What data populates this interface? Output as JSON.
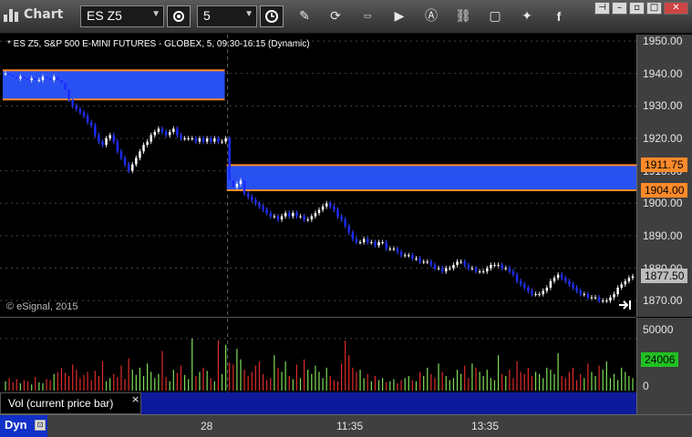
{
  "window": {
    "title": "Chart",
    "symbol": "ES Z5",
    "interval": "5"
  },
  "chart_header": "* ES Z5, S&P 500 E-MINI FUTURES - GLOBEX, 5, 09:30-16:15 (Dynamic)",
  "copyright": "© eSignal, 2015",
  "price_badges": {
    "upper": "1911.75",
    "lower": "1904.00",
    "last": "1877.50",
    "volume_last": "24006"
  },
  "volume_panel": {
    "label": "Vol (current price bar)",
    "close": "×",
    "ticks": [
      "50000",
      "0"
    ]
  },
  "time_axis": {
    "ticks": [
      "28",
      "11:35",
      "13:35"
    ]
  },
  "dyn_label": "Dyn",
  "colors": {
    "zone_fill": "#2a55ff",
    "zone_border": "#ff8a2a",
    "up_candle": "#ffffff",
    "down_candle": "#1a2bff",
    "vol_up": "#7fe05a",
    "vol_down": "#e02a2a"
  },
  "chart_data": {
    "type": "candlestick",
    "ylim": [
      1865,
      1952
    ],
    "yticks": [
      "1950.00",
      "1940.00",
      "1930.00",
      "1920.00",
      "1910.00",
      "1900.00",
      "1890.00",
      "1880.00",
      "1870.00"
    ],
    "zones": [
      {
        "from_bar": 0,
        "to_bar": 58,
        "low": 1932,
        "high": 1941
      },
      {
        "from_bar": 60,
        "to_bar": 180,
        "low": 1904,
        "high": 1911.75
      }
    ],
    "close": [
      1940,
      1939.5,
      1939,
      1938.5,
      1939,
      1938.5,
      1938,
      1938.5,
      1938,
      1938,
      1939,
      1938.5,
      1938,
      1939,
      1938,
      1937,
      1935,
      1932,
      1930,
      1929,
      1928,
      1927,
      1925,
      1924,
      1921,
      1919,
      1918,
      1920,
      1921,
      1919,
      1916,
      1914,
      1912,
      1910,
      1912,
      1914,
      1916,
      1918,
      1919,
      1921,
      1922,
      1923,
      1922,
      1921,
      1922,
      1923,
      1921,
      1920,
      1920,
      1920,
      1920,
      1919,
      1920,
      1919,
      1920,
      1919,
      1920,
      1919,
      1919,
      1920,
      1907,
      1905,
      1906,
      1907,
      1903,
      1902,
      1901,
      1900,
      1899,
      1898,
      1897,
      1896,
      1896,
      1895,
      1896,
      1897,
      1896,
      1897,
      1896,
      1896,
      1895,
      1895,
      1896,
      1897,
      1898,
      1899,
      1900,
      1899,
      1898,
      1896,
      1895,
      1893,
      1891,
      1889,
      1888,
      1888,
      1889,
      1888,
      1888,
      1887,
      1888,
      1888,
      1886,
      1886,
      1886,
      1885,
      1884,
      1884,
      1884,
      1883,
      1883,
      1882,
      1882,
      1882,
      1881,
      1880,
      1880,
      1879,
      1880,
      1880,
      1881,
      1882,
      1882,
      1881,
      1880,
      1880,
      1879,
      1879,
      1879,
      1880,
      1881,
      1881,
      1881,
      1880,
      1880,
      1879,
      1878,
      1876,
      1875,
      1874,
      1873,
      1872,
      1872,
      1872,
      1873,
      1874,
      1876,
      1877,
      1878,
      1877,
      1876,
      1875,
      1874,
      1873,
      1872,
      1872,
      1871,
      1871,
      1871,
      1870,
      1870,
      1870,
      1871,
      1872,
      1874,
      1875,
      1876,
      1877,
      1877.5
    ],
    "volume": [
      9000,
      12000,
      8000,
      11000,
      7000,
      10000,
      9000,
      6000,
      13000,
      8000,
      7000,
      11000,
      10000,
      16000,
      18000,
      22000,
      17000,
      14000,
      25000,
      20000,
      12000,
      15000,
      18000,
      10000,
      19000,
      14000,
      28000,
      9000,
      12000,
      16000,
      13000,
      24000,
      11000,
      31000,
      20000,
      15000,
      22000,
      14000,
      26000,
      18000,
      12000,
      16000,
      38000,
      13000,
      9000,
      20000,
      17000,
      24000,
      15000,
      11000,
      50000,
      14000,
      18000,
      22000,
      19000,
      12000,
      9000,
      48000,
      16000,
      44000,
      27000,
      25000,
      40000,
      30000,
      20000,
      14000,
      18000,
      24000,
      28000,
      16000,
      10000,
      12000,
      34000,
      22000,
      18000,
      28000,
      14000,
      11000,
      25000,
      12000,
      30000,
      20000,
      16000,
      24000,
      18000,
      12000,
      22000,
      14000,
      10000,
      9000,
      26000,
      48000,
      34000,
      22000,
      18000,
      20000,
      12000,
      16000,
      9000,
      14000,
      10000,
      12000,
      8000,
      9000,
      11000,
      7000,
      10000,
      12000,
      14000,
      10000,
      9000,
      18000,
      14000,
      22000,
      16000,
      12000,
      26000,
      18000,
      14000,
      10000,
      12000,
      20000,
      16000,
      24000,
      12000,
      26000,
      22000,
      18000,
      14000,
      20000,
      12000,
      10000,
      34000,
      16000,
      14000,
      20000,
      12000,
      28000,
      18000,
      16000,
      22000,
      14000,
      18000,
      16000,
      12000,
      22000,
      20000,
      16000,
      36000,
      14000,
      12000,
      18000,
      22000,
      10000,
      16000,
      12000,
      26000,
      18000,
      14000,
      24000,
      20000,
      28000,
      12000,
      16000,
      10000,
      22000,
      18000,
      14000,
      12000,
      20000,
      24000,
      16000,
      18000,
      26000,
      28000,
      44000,
      24006
    ]
  }
}
